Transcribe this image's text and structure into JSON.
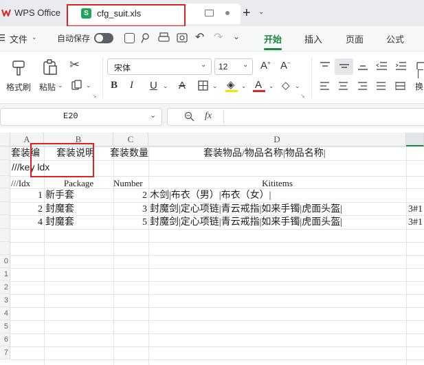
{
  "titlebar": {
    "app_name": "WPS Office",
    "tab_icon_letter": "S",
    "tab_filename": "cfg_suit.xls"
  },
  "menubar": {
    "file": "文件",
    "autosave": "自动保存",
    "tabs": [
      "开始",
      "插入",
      "页面",
      "公式"
    ]
  },
  "ribbon": {
    "format_painter": "格式刷",
    "paste": "粘贴",
    "font_name": "宋体",
    "font_size": "12",
    "wrap_label": "换"
  },
  "formula_bar": {
    "cell_ref": "E20",
    "fx": "fx",
    "formula": ""
  },
  "grid": {
    "columns": [
      "A",
      "B",
      "C",
      "D"
    ],
    "row_numbers": [
      "",
      "",
      "",
      "",
      "",
      "",
      "",
      "",
      "0",
      "1",
      "2",
      "3",
      "4",
      "5",
      "6",
      "7"
    ],
    "rows": [
      {
        "a": "套装编",
        "b": "套装说明",
        "c": "套装数量",
        "d": "套装物品/物品名称|物品名称|",
        "e": ""
      },
      {
        "a": "///key ldx",
        "b": "",
        "c": "",
        "d": "",
        "e": ""
      },
      {
        "a": "///Idx",
        "b": "Package",
        "c": "Number",
        "d": "Kititems",
        "e": ""
      },
      {
        "a": "1",
        "b": "新手套",
        "c": "2",
        "d": "木剑|布衣（男）|布衣（女）|",
        "e": ""
      },
      {
        "a": "2",
        "b": "封魔套",
        "c": "3",
        "d": "封魔剑|定心项链|青云戒指|如来手镯|虎面头盔|",
        "e": "3#1"
      },
      {
        "a": "4",
        "b": "封魔套",
        "c": "5",
        "d": "封魔剑|定心项链|青云戒指|如来手镯|虎面头盔|",
        "e": "3#1"
      }
    ]
  }
}
